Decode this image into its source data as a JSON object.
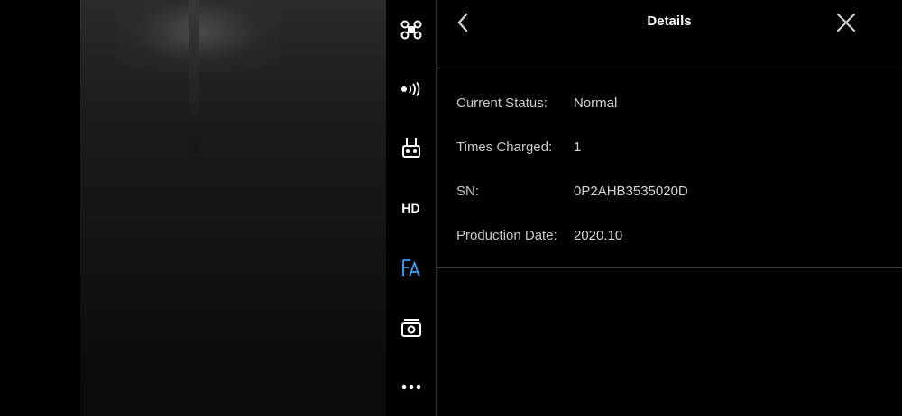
{
  "sidebar": {
    "items": [
      {
        "icon": "drone-icon"
      },
      {
        "icon": "signal-broadcast-icon"
      },
      {
        "icon": "remote-controller-icon"
      },
      {
        "icon": "hd-icon",
        "label": "HD"
      },
      {
        "icon": "exposure-af-icon",
        "active": true
      },
      {
        "icon": "camera-icon"
      },
      {
        "icon": "more-icon"
      }
    ]
  },
  "colors": {
    "accent": "#3fa3ff",
    "background": "#000000",
    "text": "#ffffff",
    "muted": "#c8c8c8",
    "divider": "#3a3a3a"
  },
  "details": {
    "title": "Details",
    "rows": [
      {
        "label": "Current Status:",
        "value": "Normal"
      },
      {
        "label": "Times Charged:",
        "value": "1"
      },
      {
        "label": "SN:",
        "value": "0P2AHB3535020D"
      },
      {
        "label": "Production Date:",
        "value": "2020.10"
      }
    ]
  }
}
